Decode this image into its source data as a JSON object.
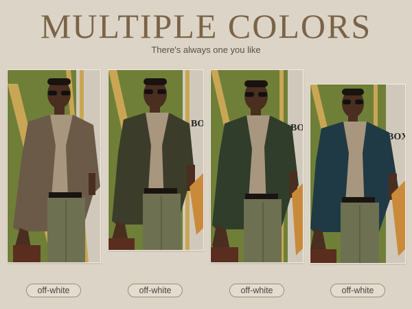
{
  "header": {
    "title": "MULTIPLE COLORS",
    "subtitle": "There's always one you like"
  },
  "variants": [
    {
      "label": "off-white",
      "jacket_color": "#6b5a48",
      "icon": "model-photo"
    },
    {
      "label": "off-white",
      "jacket_color": "#3b3d2a",
      "icon": "model-photo"
    },
    {
      "label": "off-white",
      "jacket_color": "#2f3d2a",
      "icon": "model-photo"
    },
    {
      "label": "off-white",
      "jacket_color": "#1f3a44",
      "icon": "model-photo"
    }
  ],
  "colors": {
    "background": "#dcd4c6",
    "title": "#7a6448",
    "wall_green": "#6f7f38",
    "gold_stripe": "#c9a655",
    "sweater": "#a8967e",
    "trousers": "#6e7052"
  }
}
